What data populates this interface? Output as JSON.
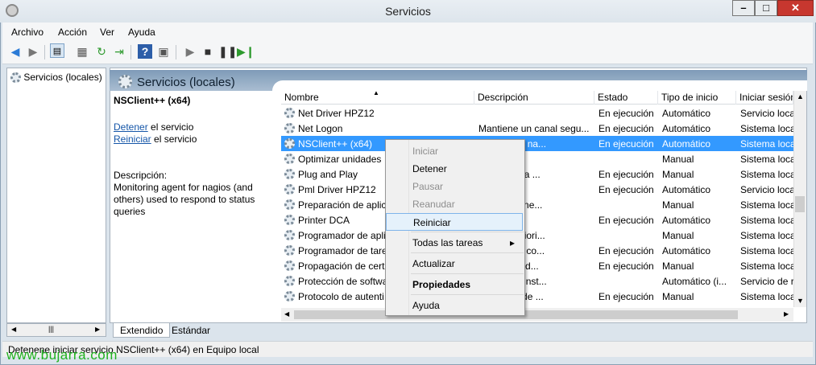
{
  "window": {
    "title": "Servicios"
  },
  "menu": [
    "Archivo",
    "Acción",
    "Ver",
    "Ayuda"
  ],
  "tree": {
    "root": "Servicios (locales)"
  },
  "panel": {
    "title": "Servicios (locales)"
  },
  "details": {
    "name": "NSClient++ (x64)",
    "stop_link": "Detener",
    "stop_suffix": " el servicio",
    "restart_link": "Reiniciar",
    "restart_suffix": " el servicio",
    "description_label": "Descripción:",
    "description": "Monitoring agent for nagios (and others) used to respond to status queries"
  },
  "columns": [
    "Nombre",
    "Descripción",
    "Estado",
    "Tipo de inicio",
    "Iniciar sesión"
  ],
  "rows": [
    {
      "name": "Net Driver HPZ12",
      "desc": "",
      "state": "En ejecución",
      "start": "Automático",
      "logon": "Servicio loca"
    },
    {
      "name": "Net Logon",
      "desc": "Mantiene un canal segu...",
      "state": "En ejecución",
      "start": "Automático",
      "logon": "Sistema loca"
    },
    {
      "name": "NSClient++ (x64)",
      "desc": "g agent for na...",
      "state": "En ejecución",
      "start": "Automático",
      "logon": "Sistema loca",
      "selected": true
    },
    {
      "name": "Optimizar unidades",
      "desc": "",
      "state": "",
      "start": "Manual",
      "logon": "Sistema loca"
    },
    {
      "name": "Plug and Play",
      "desc": "equipo para ...",
      "state": "En ejecución",
      "start": "Manual",
      "logon": "Sistema loca"
    },
    {
      "name": "Pml Driver HPZ12",
      "desc": "",
      "state": "En ejecución",
      "start": "Automático",
      "logon": "Servicio loca"
    },
    {
      "name": "Preparación de aplic",
      "desc": "s aplicacione...",
      "state": "",
      "start": "Manual",
      "logon": "Sistema loca"
    },
    {
      "name": "Printer DCA",
      "desc": "",
      "state": "En ejecución",
      "start": "Automático",
      "logon": "Sistema loca"
    },
    {
      "name": "Programador de apli",
      "desc": "tablecer priori...",
      "state": "",
      "start": "Manual",
      "logon": "Sistema loca"
    },
    {
      "name": "Programador de tare",
      "desc": "un usuario co...",
      "state": "En ejecución",
      "start": "Automático",
      "logon": "Sistema loca"
    },
    {
      "name": "Propagación de certi",
      "desc": "ertificados d...",
      "state": "En ejecución",
      "start": "Manual",
      "logon": "Sistema loca"
    },
    {
      "name": "Protección de softwa",
      "desc": "descarga, inst...",
      "state": "",
      "start": "Automático (i...",
      "logon": "Servicio de re"
    },
    {
      "name": "Protocolo de autenti",
      "desc": "Protocolo de ...",
      "state": "En ejecución",
      "start": "Manual",
      "logon": "Sistema loca"
    }
  ],
  "context_menu": [
    {
      "label": "Iniciar",
      "disabled": true
    },
    {
      "label": "Detener"
    },
    {
      "label": "Pausar",
      "disabled": true
    },
    {
      "label": "Reanudar",
      "disabled": true
    },
    {
      "label": "Reiniciar",
      "highlighted": true
    },
    {
      "label": "Todas las tareas",
      "submenu": true
    },
    {
      "label": "Actualizar"
    },
    {
      "label": "Propiedades",
      "bold": true
    },
    {
      "label": "Ayuda"
    }
  ],
  "tabs": [
    "Extendido",
    "Estándar"
  ],
  "status": "Detenene iniciar servicio NSClient++ (x64) en Equipo local",
  "watermark": "www.bujarra.com",
  "icons": {
    "back": "arrow-left-icon",
    "forward": "arrow-right-icon",
    "play": "play-icon",
    "stop": "stop-icon",
    "pause": "pause-icon",
    "restart": "restart-icon",
    "help": "help-icon"
  },
  "colors": {
    "selection": "#3399ff",
    "link": "#1556a8",
    "close": "#c7372f"
  }
}
